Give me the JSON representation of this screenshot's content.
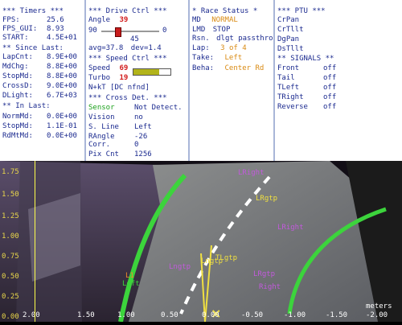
{
  "timers": {
    "header": "*** Timers ***",
    "rows": [
      {
        "label": "FPS:",
        "value": "25.6"
      },
      {
        "label": "FPS_GUI:",
        "value": "8.93"
      },
      {
        "label": "START:",
        "value": "4.5E+01"
      }
    ],
    "since_header": "** Since Last:",
    "since_rows": [
      {
        "label": "LapCnt:",
        "value": "8.9E+00"
      },
      {
        "label": "MdChg:",
        "value": "8.8E+00"
      },
      {
        "label": "StopMd:",
        "value": "8.8E+00"
      },
      {
        "label": "CrossD:",
        "value": "9.0E+00"
      },
      {
        "label": "DLight:",
        "value": "6.7E+03"
      }
    ],
    "in_header": "** In Last:",
    "in_rows": [
      {
        "label": "NormMd:",
        "value": "0.0E+00"
      },
      {
        "label": "StopMd:",
        "value": "1.1E-01"
      },
      {
        "label": "RdMtMd:",
        "value": "0.0E+00"
      }
    ]
  },
  "drive": {
    "header": "***  Drive Ctrl  ***",
    "angle_label": "Angle",
    "angle_value": "39",
    "slider_min": "90",
    "slider_max": "0",
    "slider_center": "45",
    "avg": "avg=37.8",
    "dev": "dev=1.4",
    "speed_header": "***  Speed Ctrl  ***",
    "speed_label": "Speed",
    "speed_value": "69",
    "speed_fraction": 0.69,
    "turbo_label": "Turbo",
    "turbo_value": "19",
    "nkt": "N+kT [DC nfnd]",
    "cross_header": "*** Cross Det. ***",
    "cross_rows": [
      {
        "label": "Sensor",
        "value": "Not Detect.",
        "label_class": "green"
      },
      {
        "label": "Vision",
        "value": "no"
      },
      {
        "label": "S. Line",
        "value": "Left"
      },
      {
        "label": "RAngle",
        "value": "-26"
      },
      {
        "label": "Corr.",
        "value": "0"
      },
      {
        "label": "Pix Cnt",
        "value": "1256"
      }
    ]
  },
  "race": {
    "header": "* Race Status *",
    "md_label": "MD",
    "md_value": "NORMAL",
    "lmd_label": "LMD",
    "lmd_value": "STOP",
    "rsn_label": "Rsn.",
    "rsn_value": "dlgt passthroDgPan",
    "lap_label": "Lap:",
    "lap_value": "3 of 4",
    "take_label": "Take:",
    "take_value": "Left",
    "beha_label": "Beha:",
    "beha_value": "Center Rd"
  },
  "ptu": {
    "header": "*** PTU ***",
    "items": [
      "CrPan",
      "CrTllt",
      "DgPan",
      "DsTllt"
    ],
    "signals_header": "** SIGNALS **",
    "signals": [
      {
        "label": "Front",
        "value": "off"
      },
      {
        "label": "Tail",
        "value": "off"
      },
      {
        "label": "TLeft",
        "value": "off"
      },
      {
        "label": "TRight",
        "value": "off"
      },
      {
        "label": "Reverse",
        "value": "off"
      }
    ]
  },
  "plot": {
    "y_ticks": [
      "1.75",
      "1.50",
      "1.25",
      "1.00",
      "0.75",
      "0.50",
      "0.25",
      "0.00"
    ],
    "x_ticks": [
      "2.00",
      "1.50",
      "1.00",
      "0.50",
      "0.00",
      "-0.50",
      "-1.00",
      "-1.50",
      "-2.00"
    ],
    "x_unit": "meters",
    "markers": [
      "LRight",
      "LRgtp",
      "LRight",
      "TLgtp",
      "Lngtp",
      "L1",
      "Left",
      "Lngtp",
      "LRgtp",
      "Right"
    ],
    "colors": {
      "lane": "#3cd43c",
      "marker_magenta": "#c25adc",
      "marker_orange": "#f08a2a",
      "marker_yellow": "#f0e040",
      "blue_cross": "#2a4cff"
    }
  }
}
